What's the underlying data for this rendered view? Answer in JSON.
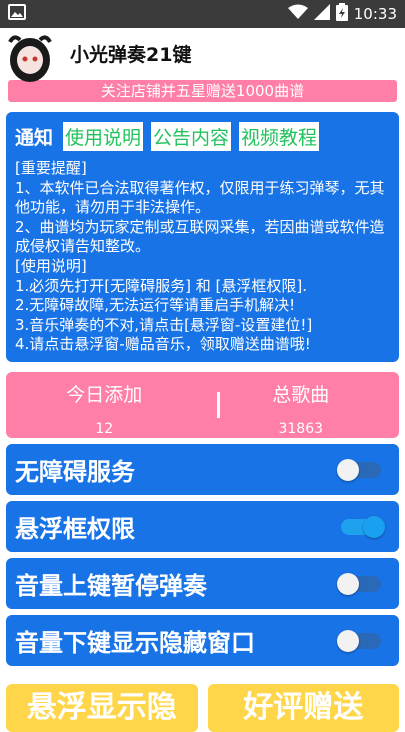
{
  "status_bar": {
    "time": "10:33",
    "icons": [
      "image-icon",
      "wifi-icon",
      "signal-icon",
      "battery-charging-icon"
    ]
  },
  "header": {
    "title": "小光弹奏21键"
  },
  "promo": {
    "text": "关注店铺并五星赠送1000曲谱"
  },
  "notice": {
    "title": "通知",
    "tabs": [
      "使用说明",
      "公告内容",
      "视频教程"
    ],
    "body": "[重要提醒]\n1、本软件已合法取得著作权，仅限用于练习弹琴，无其他功能，请勿用于非法操作。\n2、曲谱均为玩家定制或互联网采集，若因曲谱或软件造成侵权请告知整改。\n[使用说明]\n1.必须先打开[无障碍服务] 和 [悬浮框权限].\n2.无障碍故障,无法运行等请重启手机解决!\n3.音乐弹奏的不对,请点击[悬浮窗-设置建位!]\n4.请点击悬浮窗-赠品音乐，领取赠送曲谱哦!"
  },
  "stats": {
    "today_label": "今日添加",
    "today_value": "12",
    "total_label": "总歌曲",
    "total_value": "31863"
  },
  "toggles": [
    {
      "label": "无障碍服务",
      "on": false
    },
    {
      "label": "悬浮框权限",
      "on": true
    },
    {
      "label": "音量上键暂停弹奏",
      "on": false
    },
    {
      "label": "音量下键显示隐藏窗口",
      "on": false
    }
  ],
  "buttons": {
    "left": "悬浮显示隐",
    "right": "好评赠送"
  },
  "colors": {
    "primary": "#1873e6",
    "pink": "#ff7fa6",
    "green": "#22c35c",
    "yellow": "#ffd54a"
  }
}
